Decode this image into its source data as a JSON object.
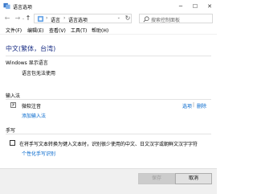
{
  "window": {
    "title": "语言选项"
  },
  "nav": {
    "breadcrumbs": [
      "语言",
      "语言选项"
    ],
    "search_placeholder": "搜索控制面板"
  },
  "menu": [
    "文件(F)",
    "编辑(E)",
    "查看(V)",
    "工具(T)",
    "帮助(H)"
  ],
  "page": {
    "heading": "中文(繁体，台湾)",
    "windows_display": {
      "title": "Windows 显示语言",
      "status": "语言包无法使用"
    },
    "ime": {
      "title": "输入法",
      "item": "微软注音",
      "options_link": "选项",
      "separator": "|",
      "delete_link": "删除",
      "add_link": "添加输入法"
    },
    "handwriting": {
      "title": "手写",
      "checkbox_label": "在将手写文本转换为键入文本时，识别很少使用的中文、日文汉字或朝鲜文汉字字符",
      "personalize_link": "个性化手写识别"
    }
  },
  "buttons": {
    "save": "保存",
    "cancel": "取消"
  },
  "colors": {
    "heading": "#1e3287",
    "link": "#0066cc"
  }
}
